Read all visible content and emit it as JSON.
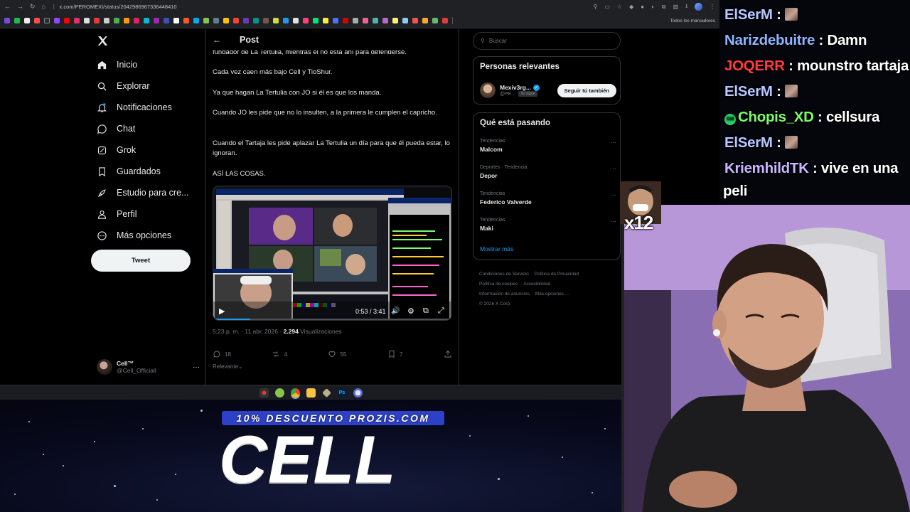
{
  "browser": {
    "url": "x.com/PEROMEXI/status/2042986967336448410",
    "bookmarks_label": "Todos los marcadores"
  },
  "nav": {
    "items": [
      {
        "label": "Inicio",
        "icon": "home-icon"
      },
      {
        "label": "Explorar",
        "icon": "search-icon"
      },
      {
        "label": "Notificaciones",
        "icon": "bell-icon"
      },
      {
        "label": "Chat",
        "icon": "chat-icon"
      },
      {
        "label": "Grok",
        "icon": "grok-icon"
      },
      {
        "label": "Guardados",
        "icon": "bookmark-icon"
      },
      {
        "label": "Estudio para cre...",
        "icon": "rocket-icon"
      },
      {
        "label": "Perfil",
        "icon": "user-icon"
      },
      {
        "label": "Más opciones",
        "icon": "more-icon"
      }
    ],
    "tweet_label": "Tweet",
    "profile_name": "Cell™",
    "profile_handle": "@Cell_Officiall"
  },
  "post": {
    "header_title": "Post",
    "paragraphs": [
      "fundador de La Tertulia, mientras él no está ahí para defenderse.",
      "Cada vez caen más bajo Cell y TioShur.",
      "Ya que hagan La Tertulia con JO si él es que los manda.",
      "Cuando JO les pide que no lo insulten, a la primera le cumplen el capricho.",
      "Cuando el Tartaja les pide aplazar La Tertulia un día para que él pueda estar, lo ignoran.",
      "ASÍ LAS COSAS."
    ],
    "video_time": "0:53 / 3:41",
    "timestamp": "5:23 p. m. · 11 abr. 2026 ·",
    "views_count": "2.294",
    "views_label": "Visualizaciones",
    "replies": "18",
    "reposts": "4",
    "likes": "55",
    "bookmarks": "7",
    "sort_label": "Relevante"
  },
  "right": {
    "search_placeholder": "Buscar",
    "people_title": "Personas relevantes",
    "person_name": "Mexiv3rg...",
    "person_handle": "@PE...",
    "person_badge": "Te sigue",
    "follow_label": "Seguir tú también",
    "trends_title": "Qué está pasando",
    "trends": [
      {
        "category": "Tendencias",
        "name": "Malcom"
      },
      {
        "category": "Deportes · Tendencia",
        "name": "Depor"
      },
      {
        "category": "Tendencias",
        "name": "Federico Valverde"
      },
      {
        "category": "Tendencias",
        "name": "Maki"
      }
    ],
    "show_more": "Mostrar más",
    "footer": [
      "Condiciones de Servicio",
      "Política de Privacidad",
      "Política de cookies",
      "Accesibilidad",
      "Información de anuncios",
      "Más opciones ...",
      "© 2026 X Corp."
    ]
  },
  "chat": [
    {
      "user": "ElSerM",
      "text": "",
      "emote": true,
      "color": "#b8c6ff"
    },
    {
      "user": "Narizdebuitre",
      "text": "Damn",
      "emote": false,
      "color": "#8fb4ff"
    },
    {
      "user": "JOQERR",
      "text": "mounstro tartaja",
      "emote": false,
      "color": "#ff3b3b"
    },
    {
      "user": "ElSerM",
      "text": "",
      "emote": true,
      "color": "#b8c6ff"
    },
    {
      "user": "Chopis_XD",
      "text": "cellsura",
      "emote": false,
      "color": "#7cfc6a",
      "badge": "Cell"
    },
    {
      "user": "ElSerM",
      "text": "",
      "emote": true,
      "color": "#b8c6ff"
    },
    {
      "user": "KriemhildTK",
      "text": "vive en una",
      "emote": false,
      "color": "#c9b6ff"
    },
    {
      "user": "",
      "text": "peli",
      "emote": false,
      "color": "#ffffff"
    }
  ],
  "overlay": {
    "sponsor": "10% DESCUENTO PROZIS.COM",
    "streamer": "CELL",
    "multiplier": "x12"
  }
}
